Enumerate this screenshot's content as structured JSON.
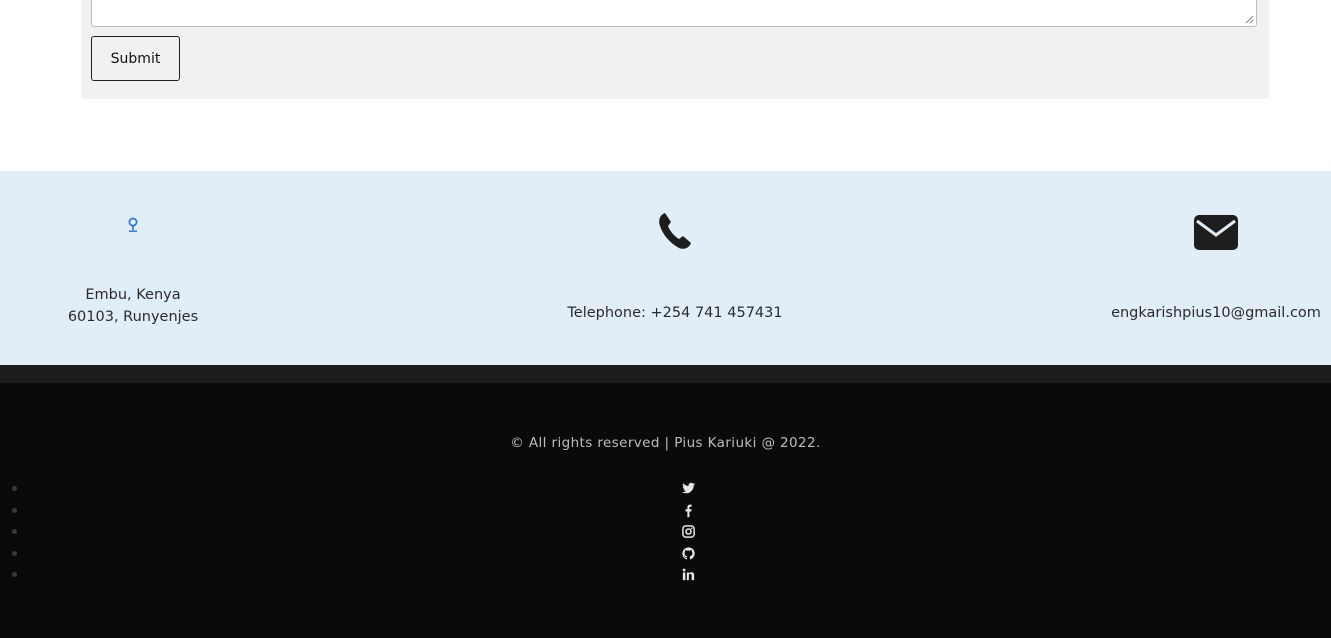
{
  "form": {
    "submit_label": "Submit"
  },
  "contact": {
    "address_line1": "Embu, Kenya",
    "address_line2": "60103, Runyenjes",
    "phone": "Telephone: +254 741 457431",
    "email": "engkarishpius10@gmail.com",
    "icons": [
      "map-pin-icon",
      "phone-icon",
      "envelope-icon"
    ]
  },
  "footer": {
    "copyright": "© All rights reserved | Pius Kariuki @ 2022.",
    "social": [
      {
        "name": "twitter-icon"
      },
      {
        "name": "facebook-icon"
      },
      {
        "name": "instagram-icon"
      },
      {
        "name": "github-icon"
      },
      {
        "name": "linkedin-icon"
      }
    ]
  },
  "colors": {
    "band_bg": "#e1eef8",
    "footer_bg": "#0a0a0a",
    "pin_accent": "#1a73e8"
  }
}
